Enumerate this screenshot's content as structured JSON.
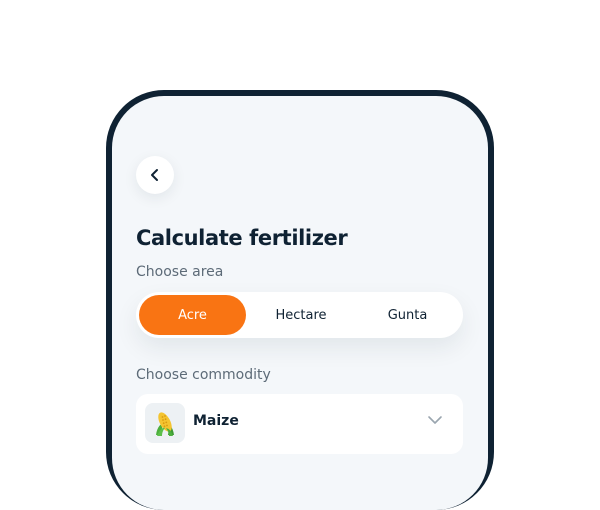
{
  "header": {
    "title": "Calculate fertilizer",
    "back_icon": "chevron-left-icon"
  },
  "area": {
    "label": "Choose area",
    "options": [
      "Acre",
      "Hectare",
      "Gunta"
    ],
    "selected": "Acre"
  },
  "commodity": {
    "label": "Choose commodity",
    "selected": "Maize",
    "icon": "corn-icon",
    "dropdown_icon": "chevron-down-icon"
  },
  "colors": {
    "accent": "#f97413",
    "frame": "#0f2233",
    "screen_background": "#f4f7fa",
    "text_primary": "#0f2233",
    "text_secondary": "#5d6b78"
  }
}
